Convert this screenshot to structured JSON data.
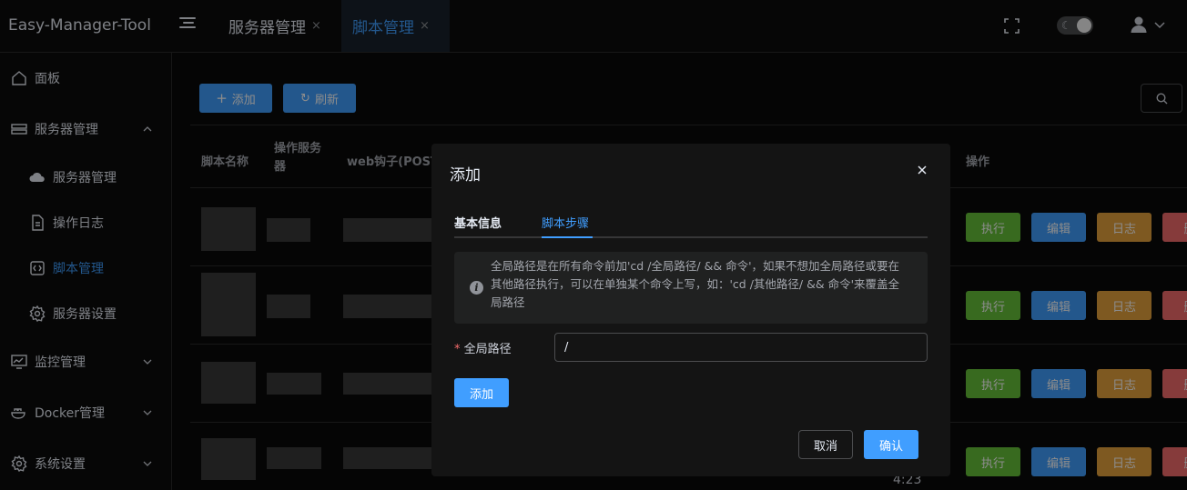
{
  "app": {
    "title": "Easy-Manager-Tool"
  },
  "header": {
    "tabs": [
      {
        "label": "服务器管理",
        "active": false
      },
      {
        "label": "脚本管理",
        "active": true
      }
    ],
    "close_glyph": "×"
  },
  "sidebar": {
    "items": [
      {
        "label": "面板",
        "icon": "home-icon"
      },
      {
        "label": "服务器管理",
        "icon": "server-icon",
        "expanded": true
      },
      {
        "label": "服务器管理",
        "icon": "cloud-icon",
        "sub": true
      },
      {
        "label": "操作日志",
        "icon": "document-icon",
        "sub": true
      },
      {
        "label": "脚本管理",
        "icon": "code-icon",
        "sub": true,
        "active": true
      },
      {
        "label": "服务器设置",
        "icon": "gear-icon",
        "sub": true
      },
      {
        "label": "监控管理",
        "icon": "monitor-icon"
      },
      {
        "label": "Docker管理",
        "icon": "docker-icon"
      },
      {
        "label": "系统设置",
        "icon": "gear-icon"
      }
    ]
  },
  "toolbar": {
    "add_label": "添加",
    "refresh_label": "刷新"
  },
  "table": {
    "headers": [
      "脚本名称",
      "操作服务器",
      "web钩子(POST",
      "操作"
    ],
    "row_actions": {
      "exec": "执行",
      "edit": "编辑",
      "log": "日志",
      "delete": "删"
    }
  },
  "dialog": {
    "title": "添加",
    "tabs": [
      "基本信息",
      "脚本步骤"
    ],
    "active_tab": "脚本步骤",
    "alert_text": "全局路径是在所有命令前加'cd /全局路径/ && 命令'，如果不想加全局路径或要在其他路径执行，可以在单独某个命令上写，如：'cd /其他路径/ && 命令'来覆盖全局路径",
    "field": {
      "required_mark": "*",
      "label": "全局路径",
      "value": "/"
    },
    "add_label": "添加",
    "cancel_label": "取消",
    "confirm_label": "确认"
  },
  "status_time": "4:23",
  "colors": {
    "primary": "#409eff",
    "success": "#67c23a",
    "warning": "#e6a23c",
    "danger": "#f56c6c"
  }
}
